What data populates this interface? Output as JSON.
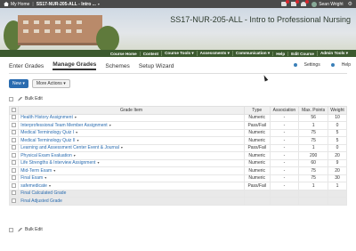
{
  "topbar": {
    "home_label": "My Home",
    "course_code": "SS17-NUR-205-ALL - Intro ...",
    "user_name": "Sean Wright"
  },
  "banner": {
    "title": "SS17-NUR-205-ALL - Intro to Professional Nursing"
  },
  "course_nav": [
    "Course Home",
    "Content",
    "Course Tools ▾",
    "Assessments ▾",
    "Communication ▾",
    "Help",
    "Edit Course",
    "Admin Tools ▾"
  ],
  "tabs": [
    "Enter Grades",
    "Manage Grades",
    "Schemes",
    "Setup Wizard"
  ],
  "active_tab": "Manage Grades",
  "top_links": {
    "settings": "Settings",
    "help": "Help"
  },
  "actions": {
    "new_label": "New ▾",
    "more_label": "More Actions ▾"
  },
  "bulk_edit": "Bulk Edit",
  "table": {
    "headers": [
      "Grade Item",
      "Type",
      "Association",
      "Max. Points",
      "Weight"
    ],
    "rows": [
      {
        "name": "Health History Assignment",
        "type": "Numeric",
        "assoc": "-",
        "max": "56",
        "weight": "10"
      },
      {
        "name": "Interprofessional Team Member Assignment",
        "type": "Pass/Fail",
        "assoc": "-",
        "max": "1",
        "weight": "0"
      },
      {
        "name": "Medical Terminology Quiz I",
        "type": "Numeric",
        "assoc": "-",
        "max": "75",
        "weight": "5"
      },
      {
        "name": "Medical Terminology Quiz II",
        "type": "Numeric",
        "assoc": "-",
        "max": "75",
        "weight": "5"
      },
      {
        "name": "Learning and Assessment Center Event & Journal",
        "type": "Pass/Fail",
        "assoc": "-",
        "max": "1",
        "weight": "0"
      },
      {
        "name": "Physical Exam Evaluation",
        "type": "Numeric",
        "assoc": "-",
        "max": "200",
        "weight": "20"
      },
      {
        "name": "Life Strengths & Interview Assignment",
        "type": "Numeric",
        "assoc": "-",
        "max": "60",
        "weight": "9"
      },
      {
        "name": "Mid-Term Exam",
        "type": "Numeric",
        "assoc": "-",
        "max": "75",
        "weight": "20"
      },
      {
        "name": "Final Exam",
        "type": "Numeric",
        "assoc": "-",
        "max": "75",
        "weight": "30"
      },
      {
        "name": "safemedicate",
        "type": "Pass/Fail",
        "assoc": "-",
        "max": "1",
        "weight": "1"
      }
    ],
    "final_rows": [
      "Final Calculated Grade",
      "Final Adjusted Grade"
    ]
  }
}
